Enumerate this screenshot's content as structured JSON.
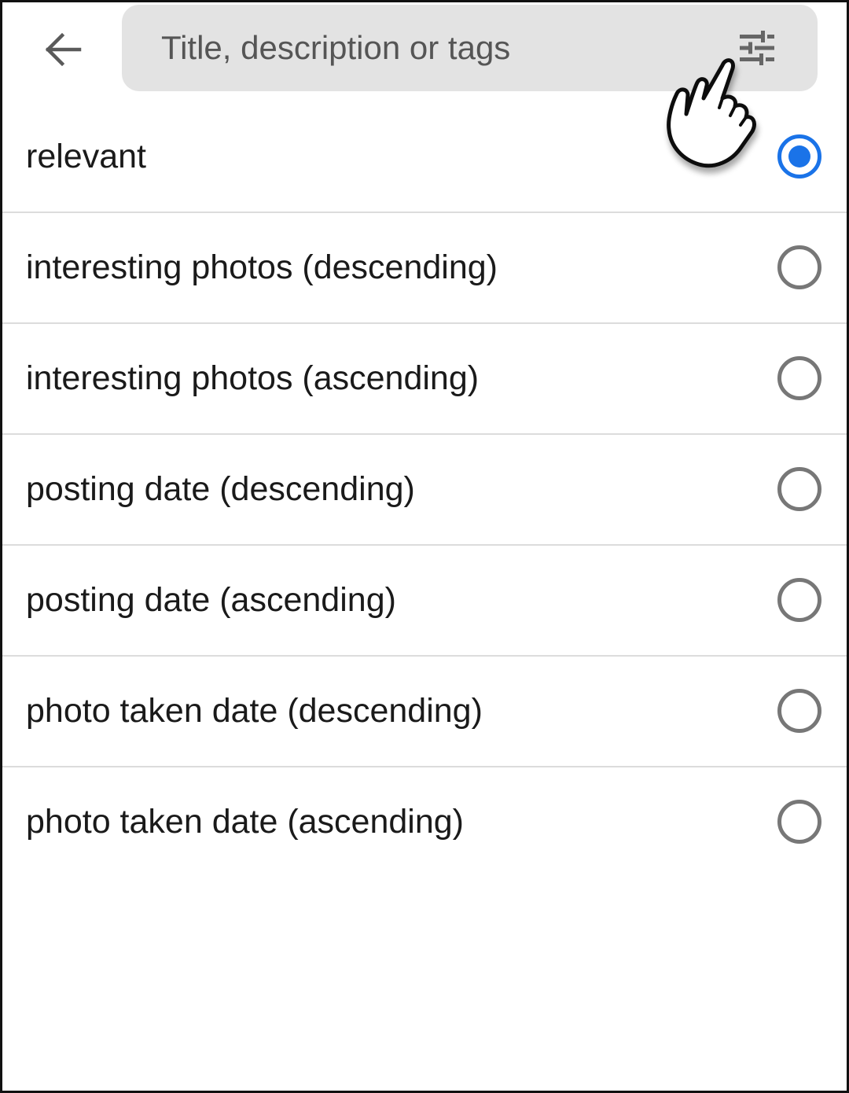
{
  "header": {
    "back_icon": "arrow-left-icon",
    "search_placeholder": "Title, description or tags",
    "search_value": "",
    "filter_icon": "tune-sliders-icon"
  },
  "sort_options": [
    {
      "label": "relevant",
      "selected": true
    },
    {
      "label": "interesting photos (descending)",
      "selected": false
    },
    {
      "label": "interesting photos (ascending)",
      "selected": false
    },
    {
      "label": "posting date (descending)",
      "selected": false
    },
    {
      "label": "posting date (ascending)",
      "selected": false
    },
    {
      "label": "photo taken date (descending)",
      "selected": false
    },
    {
      "label": "photo taken date (ascending)",
      "selected": false
    }
  ],
  "overlay": {
    "pointer_icon": "pointing-hand-icon"
  },
  "colors": {
    "accent": "#1a73e8",
    "search_bg": "#e3e3e3",
    "divider": "#dcdcdc",
    "radio_off": "#777777",
    "text": "#1a1a1a"
  }
}
